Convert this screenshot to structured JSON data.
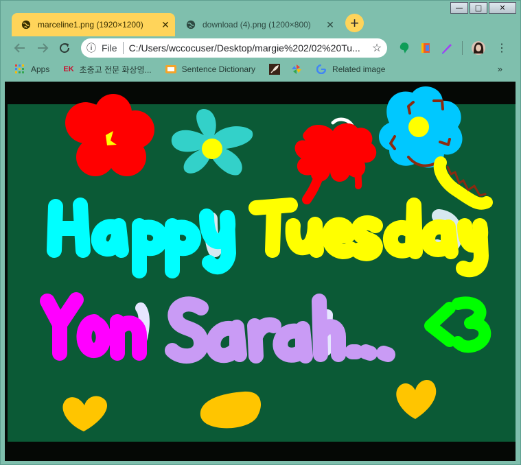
{
  "window": {
    "controls": {
      "minimize": "—",
      "maximize": "□",
      "close": "✕"
    }
  },
  "tabs": [
    {
      "title": "marceline1.png (1920×1200)",
      "active": true
    },
    {
      "title": "download (4).png (1200×800)",
      "active": false
    }
  ],
  "new_tab_label": "+",
  "toolbar": {
    "scheme_label": "File",
    "url": "C:/Users/wccocuser/Desktop/margie%202/02%20Tu..."
  },
  "bookmarks": [
    {
      "label": "Apps",
      "icon": "apps-grid-icon"
    },
    {
      "label": "초중고 전문 화상영...",
      "icon": "ek-logo-icon",
      "prefix": "EK"
    },
    {
      "label": "Sentence Dictionary",
      "icon": "sentence-dictionary-icon"
    },
    {
      "label": "",
      "icon": "feather-bookmark-icon"
    },
    {
      "label": "",
      "icon": "pinwheel-bookmark-icon"
    },
    {
      "label": "Related image",
      "icon": "google-g-icon"
    }
  ],
  "bookmarks_more": "»",
  "image": {
    "line1": "Happy Tuesday",
    "line2": "Yon Sarah ...",
    "heart_text": "<3"
  },
  "colors": {
    "frame": "#7fbfad",
    "active_tab": "#ffd45a",
    "board": "#0b5a36",
    "cyan_text": "#00ffff",
    "yellow_text": "#ffff00",
    "magenta_text": "#ff00ff",
    "lavender_text": "#c99bf5",
    "green_text": "#00ff00"
  }
}
